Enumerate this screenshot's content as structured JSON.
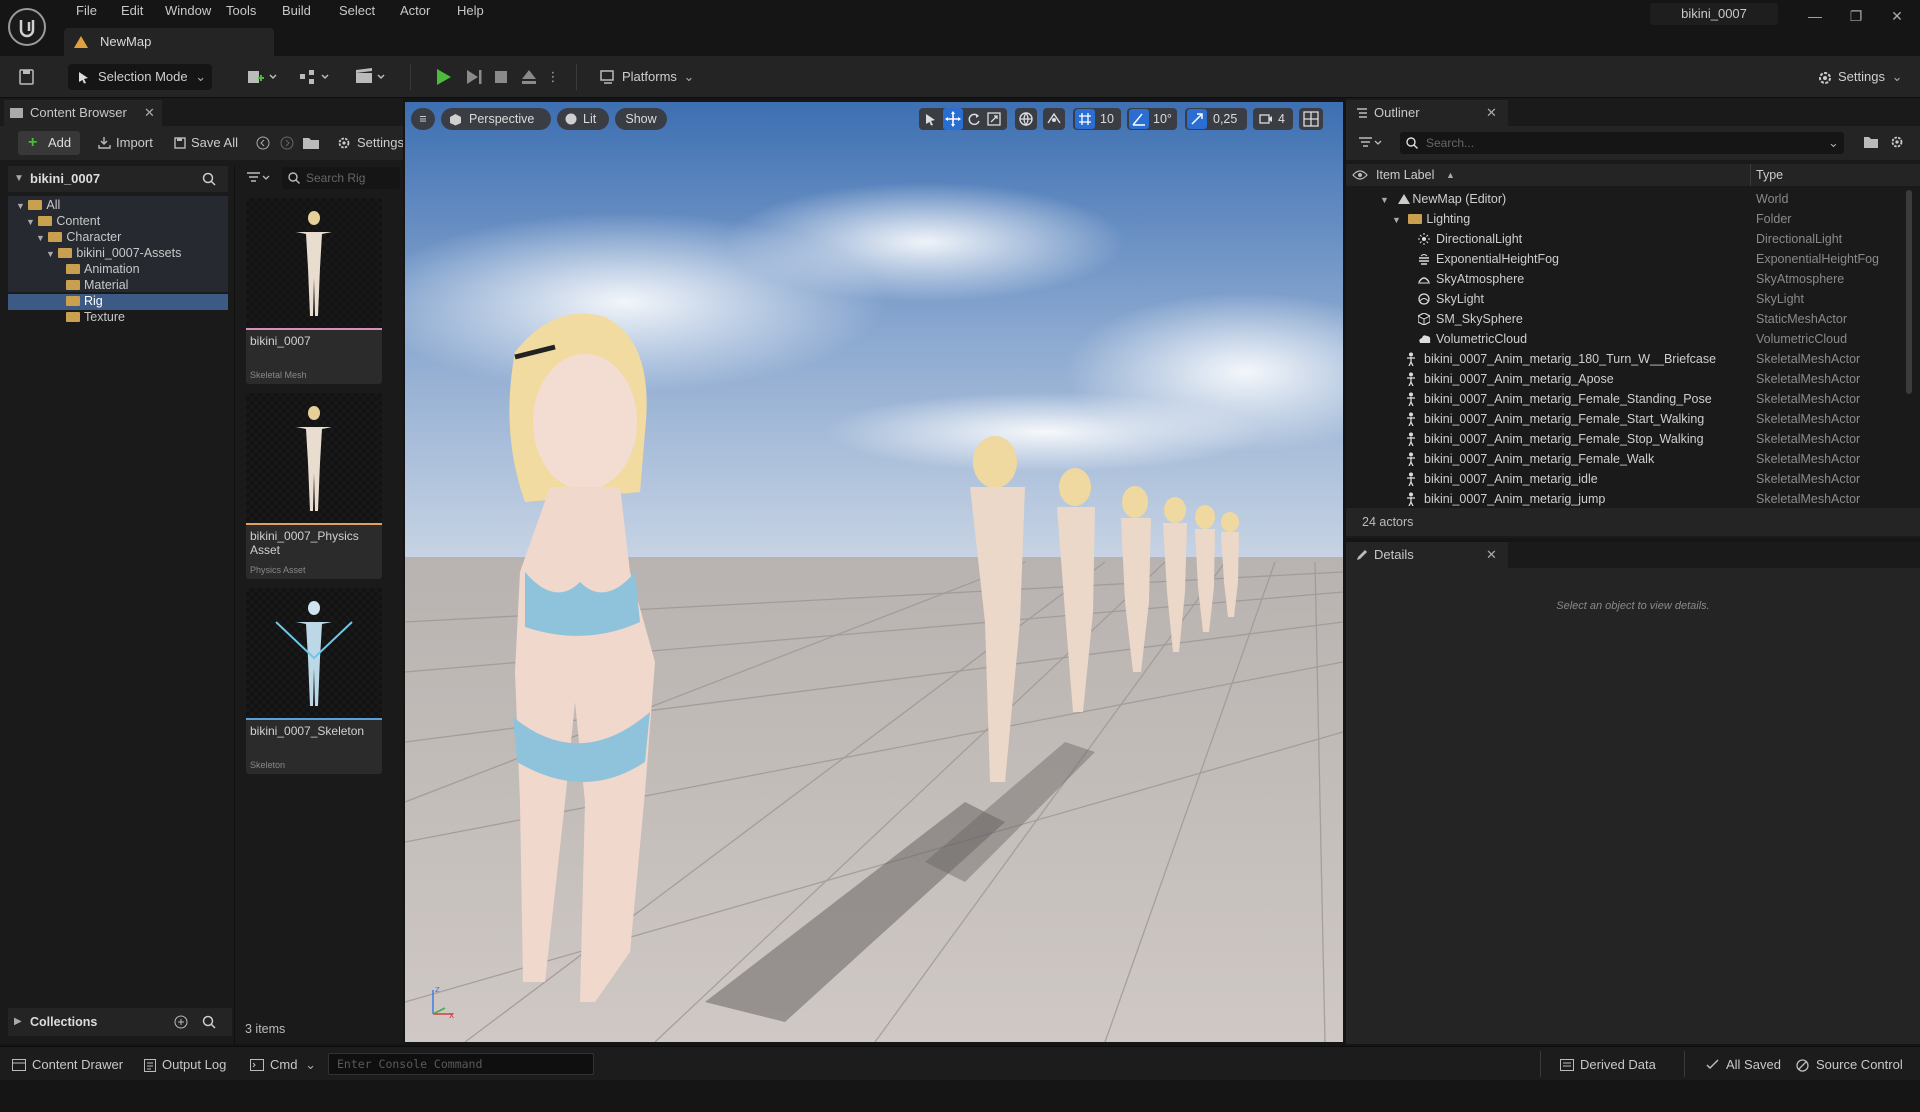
{
  "menu": [
    "File",
    "Edit",
    "Window",
    "Tools",
    "Build",
    "Select",
    "Actor",
    "Help"
  ],
  "map_tab": "NewMap",
  "project_name": "bikini_0007",
  "toolbar": {
    "selection_mode": "Selection Mode",
    "platforms": "Platforms",
    "settings": "Settings"
  },
  "content_browser": {
    "tab": "Content Browser",
    "add": "Add",
    "import": "Import",
    "save_all": "Save All",
    "settings": "Settings",
    "root": "bikini_0007",
    "search_placeholder": "Search Rig",
    "tree": [
      "All",
      "Content",
      "Character",
      "bikini_0007-Assets",
      "Animation",
      "Material",
      "Rig",
      "Texture"
    ],
    "selected_folder": "Rig",
    "collections": "Collections",
    "items_count": "3 items",
    "assets": [
      {
        "name": "bikini_0007",
        "type": "Skeletal Mesh",
        "accent": "#d68fb5"
      },
      {
        "name": "bikini_0007_Physics Asset",
        "type": "Physics Asset",
        "accent": "#e0a060"
      },
      {
        "name": "bikini_0007_Skeleton",
        "type": "Skeleton",
        "accent": "#5aa0d8"
      }
    ]
  },
  "viewport": {
    "perspective": "Perspective",
    "lit": "Lit",
    "show": "Show",
    "grid_snap": "10",
    "rot_snap": "10°",
    "scale_snap": "0,25",
    "cam_speed": "4"
  },
  "outliner": {
    "tab": "Outliner",
    "search_placeholder": "Search...",
    "col_label": "Item Label",
    "col_type": "Type",
    "rows": [
      {
        "label": "NewMap (Editor)",
        "type": "World",
        "indent": 0
      },
      {
        "label": "Lighting",
        "type": "Folder",
        "indent": 1
      },
      {
        "label": "DirectionalLight",
        "type": "DirectionalLight",
        "indent": 2
      },
      {
        "label": "ExponentialHeightFog",
        "type": "ExponentialHeightFog",
        "indent": 2
      },
      {
        "label": "SkyAtmosphere",
        "type": "SkyAtmosphere",
        "indent": 2
      },
      {
        "label": "SkyLight",
        "type": "SkyLight",
        "indent": 2
      },
      {
        "label": "SM_SkySphere",
        "type": "StaticMeshActor",
        "indent": 2
      },
      {
        "label": "VolumetricCloud",
        "type": "VolumetricCloud",
        "indent": 2
      },
      {
        "label": "bikini_0007_Anim_metarig_180_Turn_W__Briefcase",
        "type": "SkeletalMeshActor",
        "indent": 1
      },
      {
        "label": "bikini_0007_Anim_metarig_Apose",
        "type": "SkeletalMeshActor",
        "indent": 1
      },
      {
        "label": "bikini_0007_Anim_metarig_Female_Standing_Pose",
        "type": "SkeletalMeshActor",
        "indent": 1
      },
      {
        "label": "bikini_0007_Anim_metarig_Female_Start_Walking",
        "type": "SkeletalMeshActor",
        "indent": 1
      },
      {
        "label": "bikini_0007_Anim_metarig_Female_Stop_Walking",
        "type": "SkeletalMeshActor",
        "indent": 1
      },
      {
        "label": "bikini_0007_Anim_metarig_Female_Walk",
        "type": "SkeletalMeshActor",
        "indent": 1
      },
      {
        "label": "bikini_0007_Anim_metarig_idle",
        "type": "SkeletalMeshActor",
        "indent": 1
      },
      {
        "label": "bikini_0007_Anim_metarig_jump",
        "type": "SkeletalMeshActor",
        "indent": 1
      }
    ],
    "actor_count": "24 actors"
  },
  "details": {
    "tab": "Details",
    "empty_message": "Select an object to view details."
  },
  "statusbar": {
    "content_drawer": "Content Drawer",
    "output_log": "Output Log",
    "cmd": "Cmd",
    "console_placeholder": "Enter Console Command",
    "derived_data": "Derived Data",
    "all_saved": "All Saved",
    "source_control": "Source Control"
  },
  "colors": {
    "accent_green": "#4cbb3c",
    "accent_blue": "#2a6ed2",
    "folder": "#c8a050"
  }
}
